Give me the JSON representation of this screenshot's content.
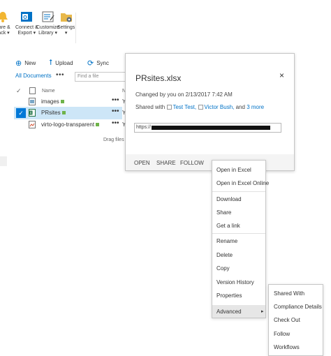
{
  "ribbon": {
    "buttons": [
      {
        "label_line1": "hare &",
        "label_line2": "rack ▾",
        "icon": "share-track-bell-icon"
      },
      {
        "label_line1": "Connect &",
        "label_line2": "Export ▾",
        "icon": "outlook-icon"
      },
      {
        "label_line1": "Customize",
        "label_line2": "Library ▾",
        "icon": "customize-form-icon"
      },
      {
        "label_line1": "Settings",
        "label_line2": "▾",
        "icon": "settings-folder-icon"
      }
    ]
  },
  "commands": {
    "new": "New",
    "upload": "Upload",
    "sync": "Sync"
  },
  "view": {
    "all_documents": "All Documents",
    "more": "•••",
    "find_placeholder": "Find a file"
  },
  "list": {
    "header_check": "✓",
    "header_name": "Name",
    "rows": [
      {
        "name": "images",
        "type": "folder",
        "selected": false,
        "more": "•••"
      },
      {
        "name": "PRsites",
        "type": "excel",
        "selected": true,
        "more": "•••"
      },
      {
        "name": "virto-logo-transparent",
        "type": "image",
        "selected": false,
        "more": "•••"
      }
    ],
    "drag_hint": "Drag files h",
    "partial_col": [
      "N",
      "Y",
      "Y",
      "Y"
    ]
  },
  "callout": {
    "title": "PRsites.xlsx",
    "close": "×",
    "changed": "Changed by you on 2/13/2017 7:42 AM",
    "shared_prefix": "Shared with",
    "shared_user1": "Test Test,",
    "shared_user2": "Victor Bush,",
    "shared_and": "and",
    "shared_more": "3 more",
    "url_prefix": "https://",
    "actions": [
      "OPEN",
      "SHARE",
      "FOLLOW"
    ]
  },
  "context_menu": {
    "items": [
      "Open in Excel",
      "Open in Excel Online",
      "Download",
      "Share",
      "Get a link",
      "Rename",
      "Delete",
      "Copy",
      "Version History",
      "Properties"
    ],
    "advanced": "Advanced",
    "advanced_arrow": "▸"
  },
  "submenu": {
    "items": [
      "Shared With",
      "Compliance Details",
      "Check Out",
      "Follow",
      "Workflows"
    ]
  },
  "colors": {
    "accent": "#0072c6",
    "selected_row": "#cde6f7",
    "check_blue": "#0078d7",
    "excel_green": "#217346"
  }
}
